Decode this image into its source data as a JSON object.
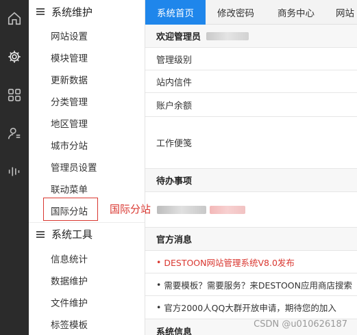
{
  "rail": {
    "icons": [
      "home-icon",
      "gear-icon",
      "grid-icon",
      "user-list-icon",
      "bars-icon"
    ]
  },
  "sidebar": {
    "group1": {
      "title": "系统维护"
    },
    "items": [
      "网站设置",
      "模块管理",
      "更新数据",
      "分类管理",
      "地区管理",
      "城市分站",
      "管理员设置",
      "联动菜单",
      "国际分站"
    ],
    "group2": {
      "title": "系统工具"
    },
    "items2": [
      "信息统计",
      "数据维护",
      "文件维护",
      "标签模板"
    ]
  },
  "tabs": [
    "系统首页",
    "修改密码",
    "商务中心",
    "网站"
  ],
  "main": {
    "welcome": "欢迎管理员",
    "admin_level": "管理级别",
    "inbox": "站内信件",
    "balance": "账户余额",
    "notes": "工作便笺",
    "todo": "待办事项",
    "news_head": "官方消息",
    "news": [
      "DESTOON网站管理系统V8.0发布",
      "需要模板？需要服务？来DESTOON应用商店搜索",
      "官方2000人QQ大群开放申请，期待您的加入"
    ],
    "sysinfo": "系统信息"
  },
  "annotation": "国际分站",
  "watermark": "CSDN @u010626187",
  "colors": {
    "accent": "#1f86eb",
    "highlight": "#d9362f",
    "rail": "#2b2b2b"
  }
}
